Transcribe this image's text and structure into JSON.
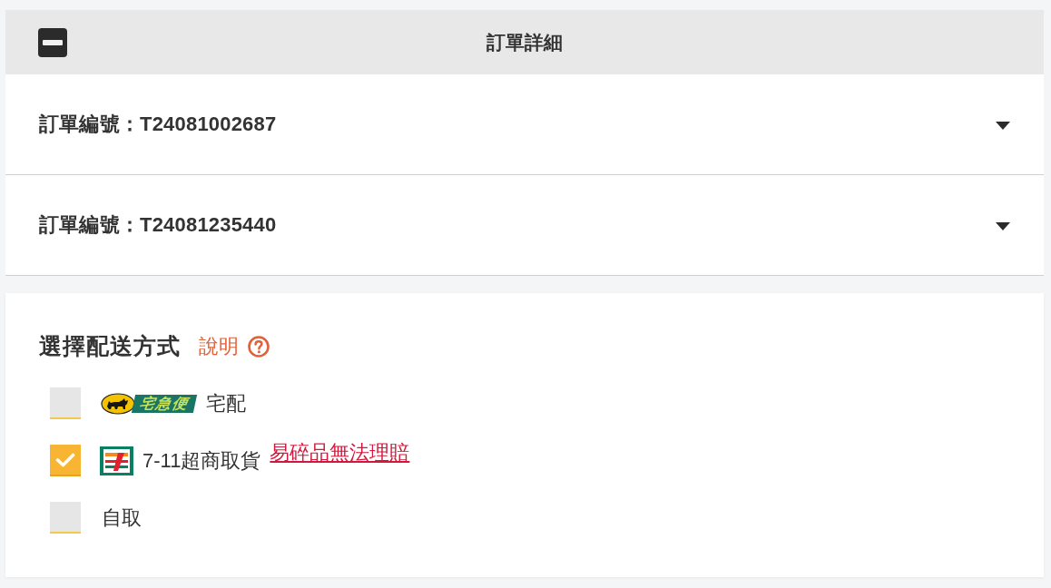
{
  "panel": {
    "title": "訂單詳細",
    "expanded": true
  },
  "orders": [
    {
      "label": "訂單編號：T24081002687",
      "expanded": false
    },
    {
      "label": "訂單編號：T24081235440",
      "expanded": false
    }
  ],
  "shipping": {
    "title": "選擇配送方式",
    "help_link": "說明",
    "options": [
      {
        "kind": "yamato",
        "logo_text": "宅急便",
        "label": "宅配",
        "selected": false
      },
      {
        "kind": "seven-eleven",
        "label": "7-11超商取貨",
        "note": "易碎品無法理賠",
        "selected": true
      },
      {
        "kind": "plain",
        "label": "自取",
        "selected": false
      }
    ]
  }
}
